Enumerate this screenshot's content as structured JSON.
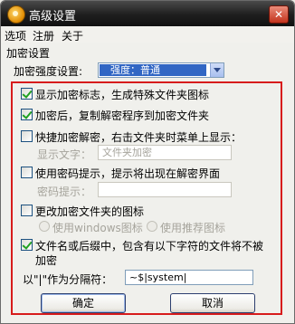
{
  "window": {
    "title": "高级设置",
    "close_glyph": "✕"
  },
  "menu": [
    "选项",
    "注册",
    "关于"
  ],
  "encrypt": {
    "section_label": "加密设置",
    "strength_label": "加密强度设置:",
    "strength_value": "强度：普通"
  },
  "options": {
    "show_marks": {
      "label": "显示加密标志，生成特殊文件夹图标",
      "checked": true
    },
    "copy_decrypt": {
      "label": "加密后，复制解密程序到加密文件夹",
      "checked": true
    },
    "quick_decrypt": {
      "label": "快捷加密解密，右击文件夹时菜单上显示：",
      "checked": false
    },
    "display_text_label": "显示文字：",
    "display_text_value": "文件夹加密",
    "password_hint": {
      "label": "使用密码提示，提示将出现在解密界面",
      "checked": false
    },
    "password_hint_label": "密码提示：",
    "password_hint_value": "",
    "change_icon": {
      "label": "更改加密文件夹的图标",
      "checked": false
    },
    "radio_windows": "使用windows图标",
    "radio_recommended": "使用推荐图标",
    "exclude_names": {
      "label_line1": "文件名或后缀中，包含有以下字符的文件将不被",
      "label_line2": "加密",
      "checked": true
    },
    "separator_label": "以\"|\"作为分隔符：",
    "separator_value": "~$|system|"
  },
  "buttons": {
    "ok": "确定",
    "cancel": "取消"
  },
  "colors": {
    "highlight_box": "#d71c1c",
    "selection": "#3166c4",
    "check": "#21a121"
  }
}
